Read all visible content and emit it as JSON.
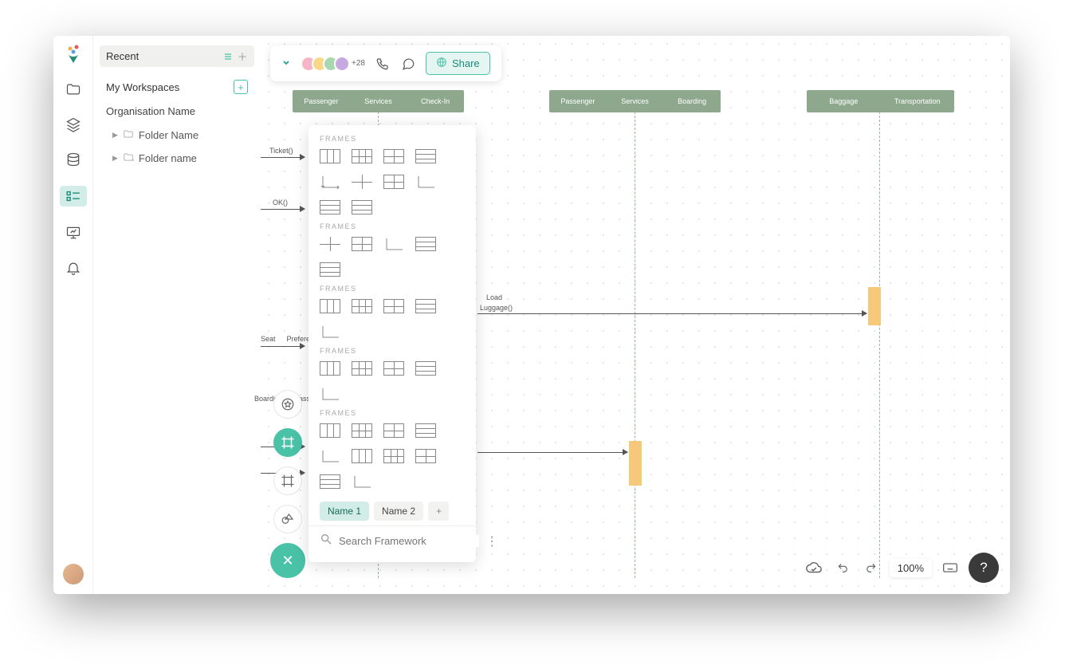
{
  "sidebar": {
    "recent_label": "Recent",
    "my_workspaces_label": "My Workspaces",
    "org_name": "Organisation Name",
    "folders": [
      {
        "label": "Folder Name"
      },
      {
        "label": "Folder name"
      }
    ]
  },
  "header": {
    "avatar_overflow": "+28",
    "share_label": "Share"
  },
  "swimlanes": {
    "group1": [
      "Passenger",
      "Services",
      "Check-In"
    ],
    "group2": [
      "Passenger",
      "Services",
      "Boarding"
    ],
    "group3": [
      "Baggage",
      "Transportation"
    ]
  },
  "interactions": {
    "ticket_label": "Ticket()",
    "ok_label": "OK()",
    "load_label": "Load",
    "luggage_label": "Luggage()",
    "seat_label": "Seat",
    "preference_label": "Preferences",
    "boarding_label": "Boarding",
    "pass_label": "Pass"
  },
  "frames_panel": {
    "section_title": "FRAMES",
    "tabs": [
      {
        "label": "Name 1"
      },
      {
        "label": "Name 2"
      }
    ],
    "search_placeholder": "Search Framework"
  },
  "bottom": {
    "zoom": "100%"
  },
  "icons": {
    "logo": "logo-icon",
    "folder": "folder-icon",
    "layers": "layers-icon",
    "database": "database-icon",
    "list": "list-icon",
    "presentation": "presentation-icon",
    "bell": "bell-icon",
    "plus": "plus-icon",
    "lines": "lines-icon",
    "caret_right": "caret-right-icon",
    "caret_down": "chevron-down-icon",
    "phone": "phone-icon",
    "chat": "chat-icon",
    "globe": "globe-icon",
    "star": "star-icon",
    "frame": "frame-icon",
    "shapes": "shapes-icon",
    "close": "close-icon",
    "cloud": "cloud-icon",
    "undo": "undo-icon",
    "redo": "redo-icon",
    "keyboard": "keyboard-icon",
    "help": "help-icon",
    "search": "search-icon",
    "dots": "more-vertical-icon"
  }
}
